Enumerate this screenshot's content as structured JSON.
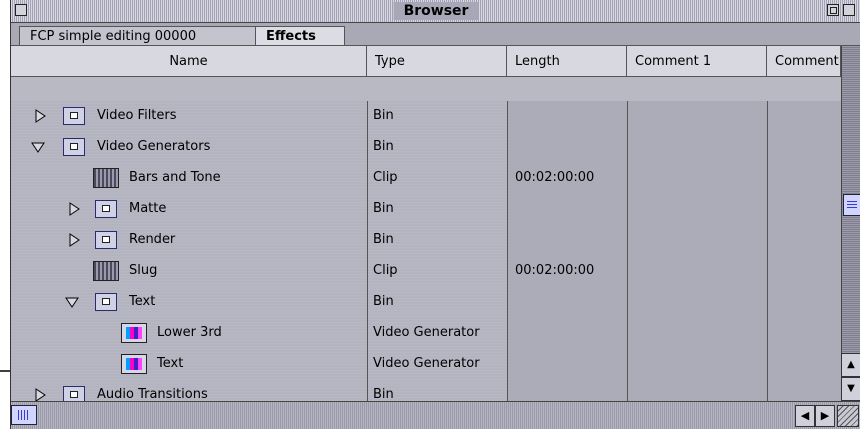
{
  "window": {
    "title": "Browser"
  },
  "tabs": [
    {
      "label": "FCP simple editing 00000"
    },
    {
      "label": "Effects"
    }
  ],
  "columns": {
    "name": "Name",
    "type": "Type",
    "length": "Length",
    "comment1": "Comment 1",
    "comment2": "Comment"
  },
  "rows": [
    {
      "name": "Video Filters",
      "type": "Bin",
      "length": "",
      "icon": "bin-icon",
      "expander": "collapsed"
    },
    {
      "name": "Video Generators",
      "type": "Bin",
      "length": "",
      "icon": "bin-icon",
      "expander": "expanded"
    },
    {
      "name": "Bars and Tone",
      "type": "Clip",
      "length": "00:02:00:00",
      "icon": "clip-icon",
      "expander": "none"
    },
    {
      "name": "Matte",
      "type": "Bin",
      "length": "",
      "icon": "bin-icon",
      "expander": "collapsed"
    },
    {
      "name": "Render",
      "type": "Bin",
      "length": "",
      "icon": "bin-icon",
      "expander": "collapsed"
    },
    {
      "name": "Slug",
      "type": "Clip",
      "length": "00:02:00:00",
      "icon": "clip-icon",
      "expander": "none"
    },
    {
      "name": "Text",
      "type": "Bin",
      "length": "",
      "icon": "bin-icon",
      "expander": "expanded"
    },
    {
      "name": "Lower 3rd",
      "type": "Video Generator",
      "length": "",
      "icon": "generator-icon",
      "expander": "none"
    },
    {
      "name": "Text",
      "type": "Video Generator",
      "length": "",
      "icon": "generator-icon",
      "expander": "none"
    },
    {
      "name": "Audio Transitions",
      "type": "Bin",
      "length": "",
      "icon": "bin-icon",
      "expander": "collapsed"
    }
  ]
}
